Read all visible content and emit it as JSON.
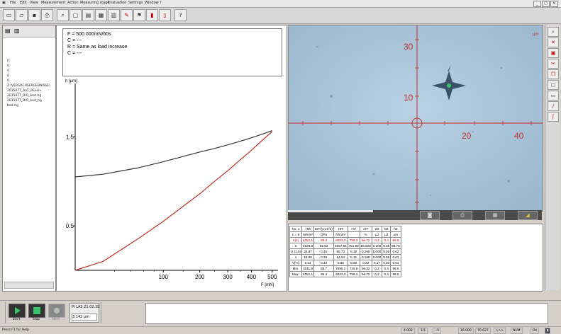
{
  "menu": [
    "File",
    "Edit",
    "View",
    "Measurement",
    "Action",
    "Measuring stage",
    "Evaluation",
    "Settings",
    "Window",
    "?"
  ],
  "toolbar_icons": [
    "new-icon",
    "open-icon",
    "save-icon",
    "print-icon",
    "separator",
    "zoom-icon",
    "window-icon",
    "chart-icon",
    "grid-icon",
    "table-icon",
    "red-marker-icon",
    "flag-icon",
    "red-stack-icon",
    "red-bar-icon",
    "cursor-help-icon"
  ],
  "left_tree": [
    "[]",
    "0",
    "0",
    "0",
    "0",
    "Z:\\VERSUCHSERGEBNISSE\\",
    "201507T_AuT_BEseiv",
    "201507T_BIO_bed-hg",
    "201507T_BIO_bed_hg",
    "bed-hg"
  ],
  "legend": {
    "line1": "F = 500.000mN/60s",
    "line2": "C = ---",
    "line3": "R = Same as load increase",
    "line4": "C = ---"
  },
  "chart_data": {
    "type": "line",
    "title": "",
    "xlabel": "F [mN]",
    "ylabel": "h [µm]",
    "x_scale": "sqrt",
    "xlim": [
      0,
      530
    ],
    "ylim": [
      0,
      2.1
    ],
    "xticks": [
      100,
      200,
      300,
      400,
      500
    ],
    "yticks": [
      0.5,
      1.5
    ],
    "ytick_labels": [
      "0.5",
      "1.5"
    ],
    "xtick_labels": [
      "100",
      "200",
      "300",
      "400",
      "500"
    ],
    "series": [
      {
        "name": "",
        "x": [
          0,
          10,
          50,
          100,
          150,
          200,
          250,
          300,
          350,
          400,
          450,
          500
        ],
        "y": [
          0.0,
          0.1,
          0.35,
          0.55,
          0.72,
          0.86,
          1.0,
          1.12,
          1.24,
          1.35,
          1.46,
          1.56
        ],
        "color": "#c0302a"
      },
      {
        "name": "",
        "x": [
          0,
          10,
          50,
          100,
          150,
          200,
          250,
          300,
          350,
          400,
          450,
          500
        ],
        "y": [
          1.05,
          1.08,
          1.15,
          1.22,
          1.28,
          1.33,
          1.37,
          1.41,
          1.45,
          1.49,
          1.53,
          1.57
        ],
        "color": "#333333"
      }
    ]
  },
  "image_axis": {
    "ylabels": [
      "30",
      "10"
    ],
    "xlabels": [
      "20",
      "40"
    ],
    "unit": "µm",
    "line_color": "#c0302a"
  },
  "table": {
    "headers": [
      "No. 1",
      "HM",
      "EIT/(1-vs^2)",
      "HIT",
      "HV",
      "nIT",
      "Wt",
      "Wt",
      "h0"
    ],
    "units": [
      "n = 8",
      "N/mm²",
      "GPa",
      "N/mm²",
      "",
      "%",
      "µJ",
      "µJ",
      "µm"
    ],
    "rows": [
      [
        "X(1)",
        "4051.1",
        "86.4",
        "6023.3",
        "758.2",
        "56.72",
        "0.2",
        "0.4",
        "99.8"
      ],
      [
        "X",
        "4026.9",
        "86.03",
        "5957.56",
        "751.88",
        "56.503",
        "0.200",
        "0.35",
        "99.78"
      ],
      [
        "U (1.5)",
        "26.87",
        "0.45",
        "85.73",
        "8.19",
        "0.299",
        "0.000",
        "0.00",
        "0.02"
      ],
      [
        "s",
        "16.99",
        "0.29",
        "54.54",
        "5.15",
        "0.188",
        "0.000",
        "0.00",
        "0.01"
      ],
      [
        "V[%]",
        "0.42",
        "0.33",
        "0.88",
        "0.68",
        "0.33",
        "0.17",
        "0.30",
        "0.01"
      ],
      [
        "Min.",
        "4011.8",
        "85.7",
        "7895.2",
        "745.8",
        "56.32",
        "0.2",
        "0.4",
        "99.8"
      ],
      [
        "Max.",
        "4051.1",
        "86.4",
        "6023.3",
        "758.2",
        "56.72",
        "0.2",
        "0.4",
        "99.8"
      ]
    ]
  },
  "bottom": {
    "start_label": "Start",
    "stop_label": "Stop",
    "next_label": "Next",
    "info_line1": "PI LAS 21.02.20",
    "info_line2": "3.142 µm"
  },
  "status": {
    "left": "Press F1 for Help",
    "fields": [
      "4.002",
      "1/1",
      "--5",
      "16.000",
      "70.627",
      ">>>",
      "NUM",
      "On"
    ]
  },
  "right_tools": [
    "zoom-icon",
    "close-icon",
    "layer-icon",
    "scissors-icon",
    "copy-icon",
    "paste-icon",
    "frame-icon",
    "measure-icon",
    "hook-icon"
  ]
}
